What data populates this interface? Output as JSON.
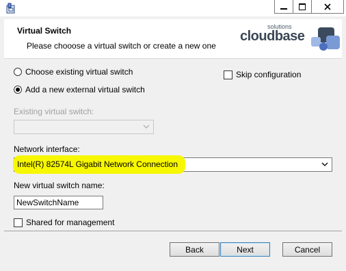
{
  "window": {
    "icon": "installer-icon",
    "minimize_icon": "minimize-icon",
    "maximize_icon": "maximize-icon",
    "close_icon": "close-icon"
  },
  "header": {
    "title": "Virtual Switch",
    "subtitle": "Please chooose a virtual switch or create a new one",
    "logo": {
      "small_text": "solutions",
      "word": "cloudbase"
    }
  },
  "options": {
    "choose_existing_label": "Choose existing virtual switch",
    "add_new_label": "Add a new external virtual switch",
    "selected": "add_new",
    "skip_configuration_label": "Skip configuration",
    "skip_configuration_checked": false
  },
  "existing_switch": {
    "label": "Existing virtual switch:",
    "value": "",
    "enabled": false
  },
  "network_interface": {
    "label": "Network interface:",
    "value": "Intel(R) 82574L Gigabit Network Connection",
    "highlight_color": "#f7f700"
  },
  "new_switch": {
    "label": "New virtual switch name:",
    "value": "NewSwitchName"
  },
  "shared": {
    "label": "Shared for management",
    "checked": false
  },
  "buttons": {
    "back": "Back",
    "next": "Next",
    "cancel": "Cancel"
  }
}
